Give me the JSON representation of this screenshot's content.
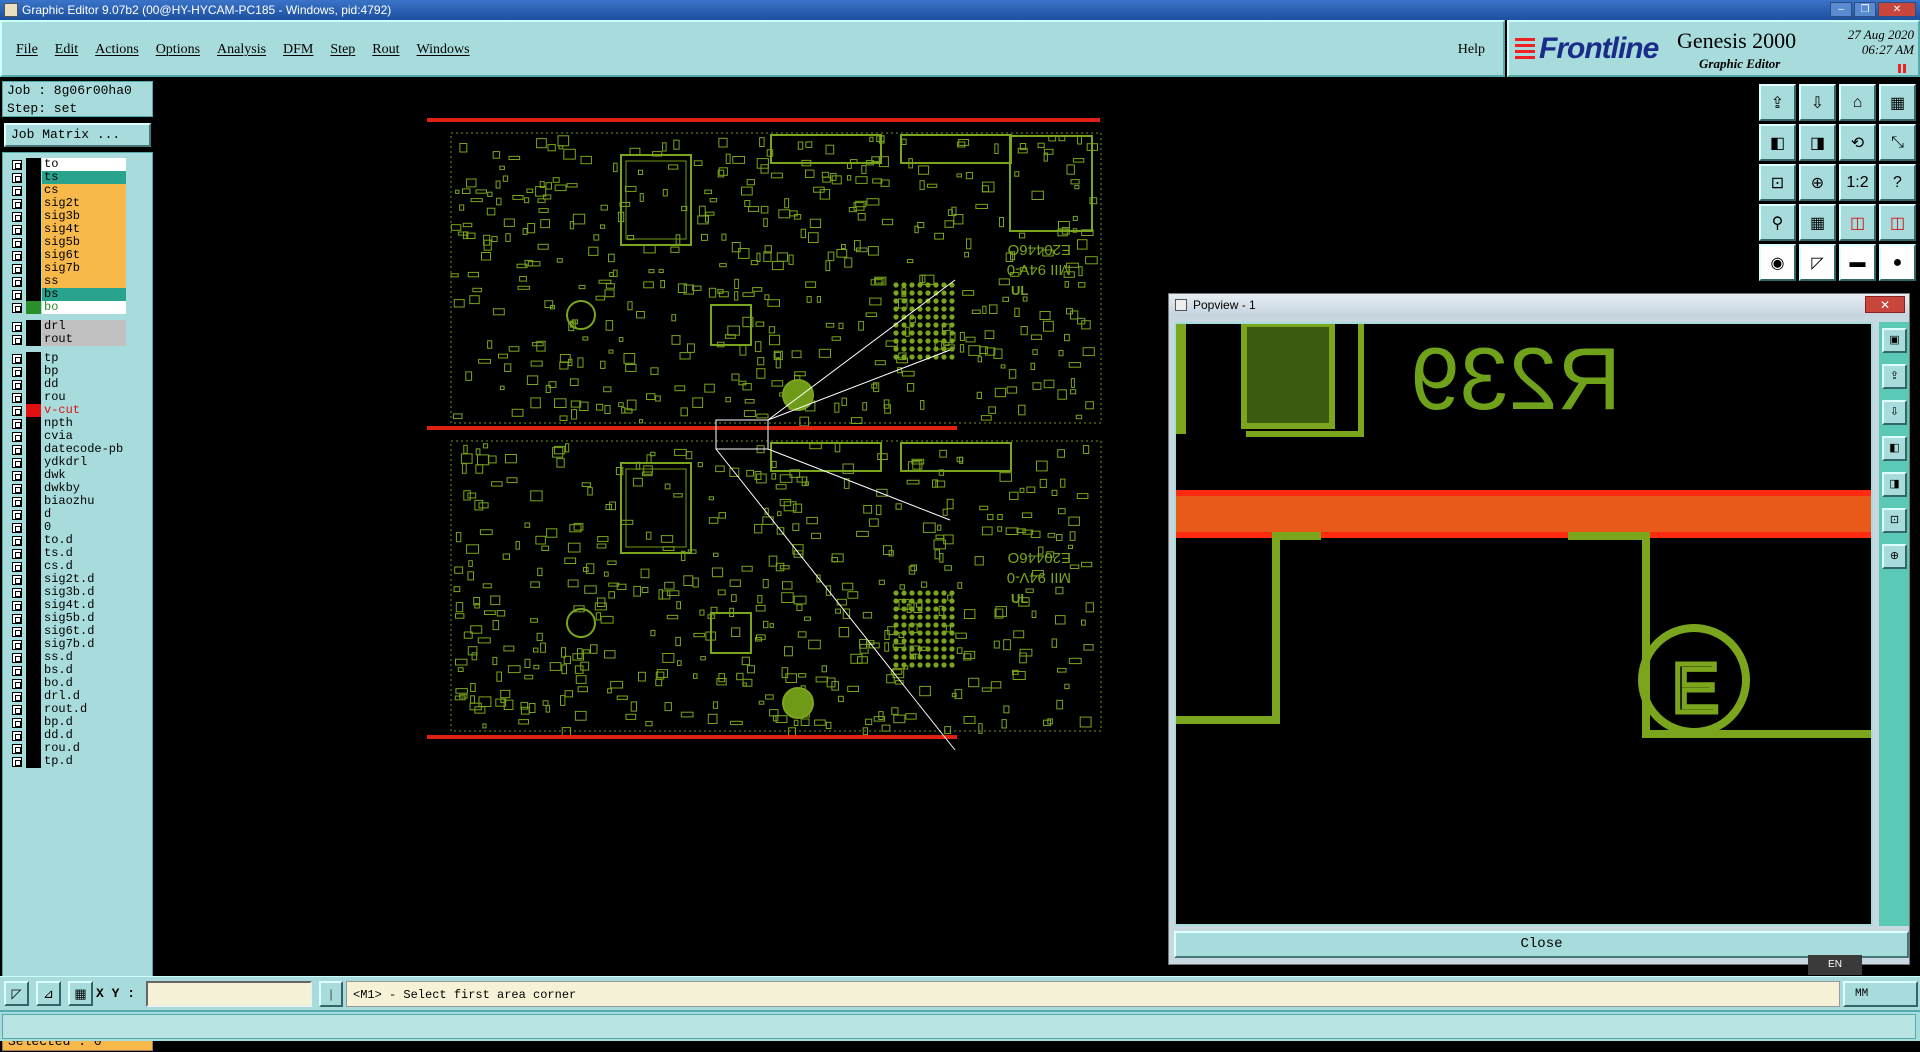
{
  "window": {
    "title": "Graphic Editor 9.07b2 (00@HY-HYCAM-PC185 - Windows, pid:4792)",
    "buttons": [
      "–",
      "❐",
      "✕"
    ]
  },
  "menu": {
    "items": [
      "File",
      "Edit",
      "Actions",
      "Options",
      "Analysis",
      "DFM",
      "Step",
      "Rout",
      "Windows"
    ],
    "help": "Help"
  },
  "brand": {
    "logo": "Frontline",
    "product": "Genesis 2000",
    "subtitle": "Graphic Editor",
    "date": "27 Aug 2020",
    "time": "06:27 AM"
  },
  "job": {
    "job_line": "Job : 8g06r00ha0",
    "step_line": "Step: set",
    "matrix_button": "Job Matrix ..."
  },
  "layers": [
    {
      "name": "to",
      "bg": "#ffffff",
      "color": "#000000"
    },
    {
      "name": "ts",
      "bg": "#2aa38c",
      "color": "#000000"
    },
    {
      "name": "cs",
      "bg": "#f7b94a",
      "color": "#000000"
    },
    {
      "name": "sig2t",
      "bg": "#f7b94a",
      "color": "#000000"
    },
    {
      "name": "sig3b",
      "bg": "#f7b94a",
      "color": "#000000"
    },
    {
      "name": "sig4t",
      "bg": "#f7b94a",
      "color": "#000000"
    },
    {
      "name": "sig5b",
      "bg": "#f7b94a",
      "color": "#000000"
    },
    {
      "name": "sig6t",
      "bg": "#f7b94a",
      "color": "#000000"
    },
    {
      "name": "sig7b",
      "bg": "#f7b94a",
      "color": "#000000"
    },
    {
      "name": "ss",
      "bg": "#f7b94a",
      "color": "#000000"
    },
    {
      "name": "bs",
      "bg": "#2aa38c",
      "color": "#000000"
    },
    {
      "name": "bo",
      "bg": "#ffffff",
      "color": "#2a8f2a"
    },
    {
      "name": "drl",
      "bg": "#c0c0c0",
      "color": "#000000"
    },
    {
      "name": "rout",
      "bg": "#c0c0c0",
      "color": "#000000"
    },
    {
      "name": "tp",
      "bg": "#a8dcdc",
      "color": "#000000"
    },
    {
      "name": "bp",
      "bg": "#a8dcdc",
      "color": "#000000"
    },
    {
      "name": "dd",
      "bg": "#a8dcdc",
      "color": "#000000"
    },
    {
      "name": "rou",
      "bg": "#a8dcdc",
      "color": "#000000"
    },
    {
      "name": "v-cut",
      "bg": "#a8dcdc",
      "color": "#e01010"
    },
    {
      "name": "npth",
      "bg": "#a8dcdc",
      "color": "#000000"
    },
    {
      "name": "cvia",
      "bg": "#a8dcdc",
      "color": "#000000"
    },
    {
      "name": "datecode-pb",
      "bg": "#a8dcdc",
      "color": "#000000"
    },
    {
      "name": "ydkdrl",
      "bg": "#a8dcdc",
      "color": "#000000"
    },
    {
      "name": "dwk",
      "bg": "#a8dcdc",
      "color": "#000000"
    },
    {
      "name": "dwkby",
      "bg": "#a8dcdc",
      "color": "#000000"
    },
    {
      "name": "biaozhu",
      "bg": "#a8dcdc",
      "color": "#000000"
    },
    {
      "name": "d",
      "bg": "#a8dcdc",
      "color": "#000000"
    },
    {
      "name": "0",
      "bg": "#a8dcdc",
      "color": "#000000"
    },
    {
      "name": "to.d",
      "bg": "#a8dcdc",
      "color": "#000000"
    },
    {
      "name": "ts.d",
      "bg": "#a8dcdc",
      "color": "#000000"
    },
    {
      "name": "cs.d",
      "bg": "#a8dcdc",
      "color": "#000000"
    },
    {
      "name": "sig2t.d",
      "bg": "#a8dcdc",
      "color": "#000000"
    },
    {
      "name": "sig3b.d",
      "bg": "#a8dcdc",
      "color": "#000000"
    },
    {
      "name": "sig4t.d",
      "bg": "#a8dcdc",
      "color": "#000000"
    },
    {
      "name": "sig5b.d",
      "bg": "#a8dcdc",
      "color": "#000000"
    },
    {
      "name": "sig6t.d",
      "bg": "#a8dcdc",
      "color": "#000000"
    },
    {
      "name": "sig7b.d",
      "bg": "#a8dcdc",
      "color": "#000000"
    },
    {
      "name": "ss.d",
      "bg": "#a8dcdc",
      "color": "#000000"
    },
    {
      "name": "bs.d",
      "bg": "#a8dcdc",
      "color": "#000000"
    },
    {
      "name": "bo.d",
      "bg": "#a8dcdc",
      "color": "#000000"
    },
    {
      "name": "drl.d",
      "bg": "#a8dcdc",
      "color": "#000000"
    },
    {
      "name": "rout.d",
      "bg": "#a8dcdc",
      "color": "#000000"
    },
    {
      "name": "bp.d",
      "bg": "#a8dcdc",
      "color": "#000000"
    },
    {
      "name": "dd.d",
      "bg": "#a8dcdc",
      "color": "#000000"
    },
    {
      "name": "rou.d",
      "bg": "#a8dcdc",
      "color": "#000000"
    },
    {
      "name": "tp.d",
      "bg": "#a8dcdc",
      "color": "#000000"
    }
  ],
  "selected": "Selected : 0",
  "toolbar": {
    "icons": [
      "save-icon",
      "load-icon",
      "home-icon",
      "panel-icon",
      "prev-icon",
      "next-icon",
      "redraw-icon",
      "pan-icon",
      "fit-icon",
      "zoom-fit-icon",
      "scale-1-2-icon",
      "help-icon",
      "snap-icon",
      "grid-icon",
      "layer-red-icon",
      "layer-red-2-icon",
      "camera-icon",
      "measure-icon",
      "ruler-icon",
      "record-icon"
    ],
    "labels": [
      "⇪",
      "⇩",
      "⌂",
      "▦",
      "◧",
      "◨",
      "⟲",
      "⤡",
      "⊡",
      "⊕",
      "1:2",
      "?",
      "⚲",
      "▦",
      "◫",
      "◫",
      "◉",
      "◸",
      "▬",
      "●"
    ]
  },
  "popview": {
    "title": "Popview - 1",
    "close_x": "✕",
    "label": "R239",
    "marker": "E",
    "close_button": "Close",
    "side_labels": [
      "▣",
      "⇪",
      "⇩",
      "◧",
      "◨",
      "⊡",
      "⊕"
    ]
  },
  "board": {
    "text_main": "E20446O",
    "text_ul": "MII 94V-0",
    "text_logo": "UL",
    "colors": {
      "trace": "#7aa51c",
      "vcut": "#e02010",
      "silk": "#6f9a18"
    }
  },
  "status": {
    "xy_label": "X Y :",
    "xy_value": "",
    "message": "<M1> - Select first area corner",
    "unit": "MM",
    "ime": "EN"
  }
}
